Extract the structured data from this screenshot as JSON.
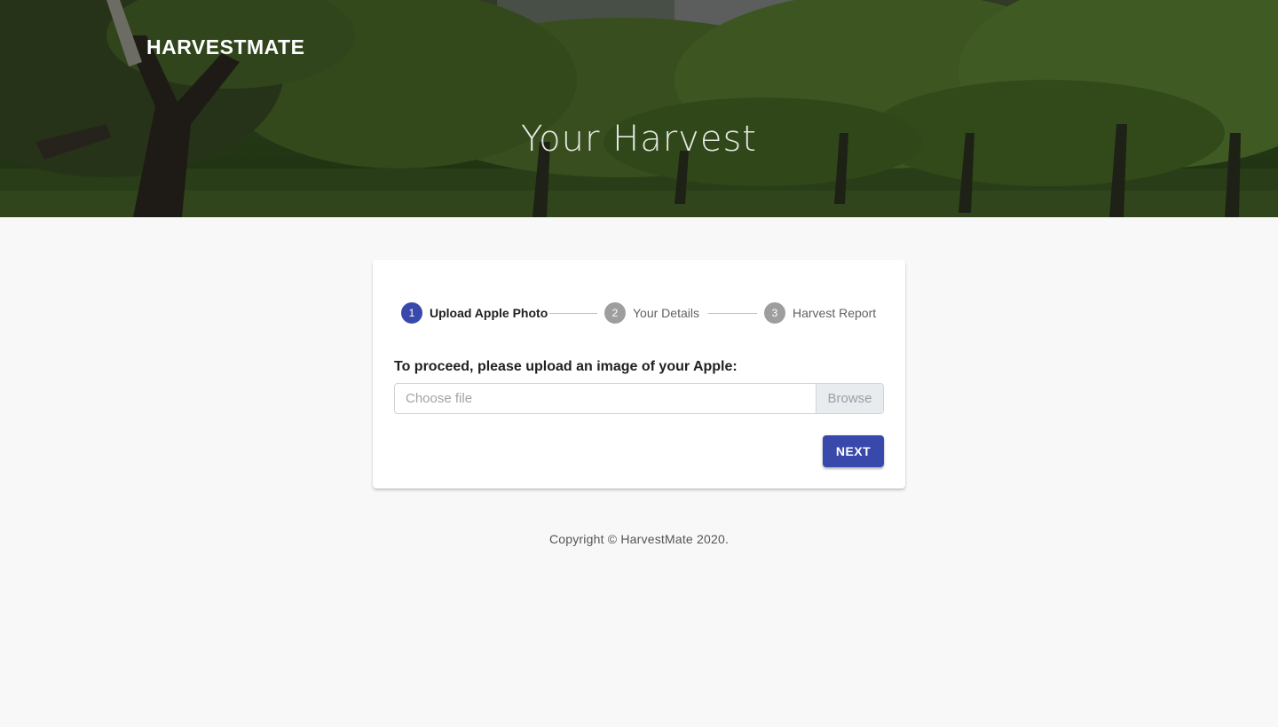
{
  "header": {
    "brand": "HARVESTMATE",
    "title": "Your Harvest",
    "background_image": "apple-orchard-photo"
  },
  "stepper": {
    "steps": [
      {
        "number": "1",
        "label": "Upload Apple Photo",
        "state": "active"
      },
      {
        "number": "2",
        "label": "Your Details",
        "state": "inactive"
      },
      {
        "number": "3",
        "label": "Harvest Report",
        "state": "inactive"
      }
    ]
  },
  "upload": {
    "prompt": "To proceed, please upload an image of your Apple:",
    "placeholder": "Choose file",
    "browse_label": "Browse"
  },
  "actions": {
    "next_label": "NEXT"
  },
  "footer": {
    "copyright": "Copyright © HarvestMate 2020."
  },
  "colors": {
    "accent": "#3949ab",
    "inactive_step": "#9e9e9e",
    "page_background": "#f8f8f8"
  }
}
